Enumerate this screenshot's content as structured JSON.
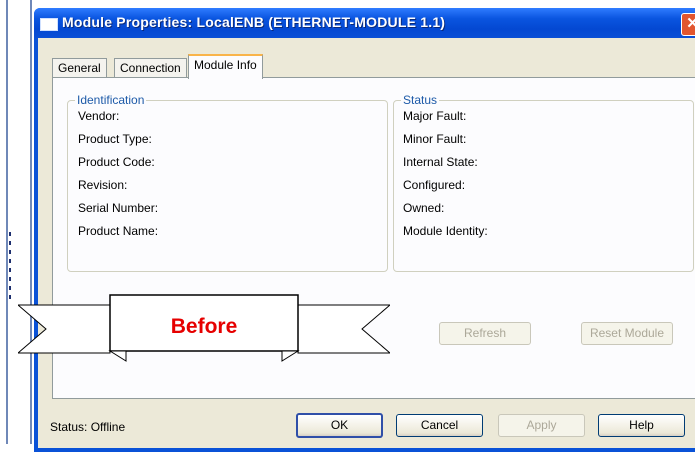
{
  "window": {
    "title": "Module Properties: LocalENB (ETHERNET-MODULE 1.1)",
    "close_glyph": "✕"
  },
  "tabs": [
    {
      "label": "General",
      "active": false
    },
    {
      "label": "Connection",
      "active": false
    },
    {
      "label": "Module Info",
      "active": true
    }
  ],
  "identification": {
    "title": "Identification",
    "fields": [
      "Vendor:",
      "Product Type:",
      "Product Code:",
      "Revision:",
      "Serial Number:",
      "Product Name:"
    ]
  },
  "status_group": {
    "title": "Status",
    "fields": [
      "Major Fault:",
      "Minor Fault:",
      "Internal State:",
      "Configured:",
      "Owned:",
      "Module Identity:"
    ]
  },
  "buttons": {
    "refresh": "Refresh",
    "reset_module": "Reset Module",
    "ok": "OK",
    "cancel": "Cancel",
    "apply": "Apply",
    "help": "Help"
  },
  "status_bar": {
    "text": "Status:  Offline"
  },
  "annotation": {
    "label": "Before",
    "color": "#e60000"
  },
  "colors": {
    "titlebar": "#0a52d7",
    "dialog": "#ece9d8",
    "group_title": "#1d5aa8"
  }
}
